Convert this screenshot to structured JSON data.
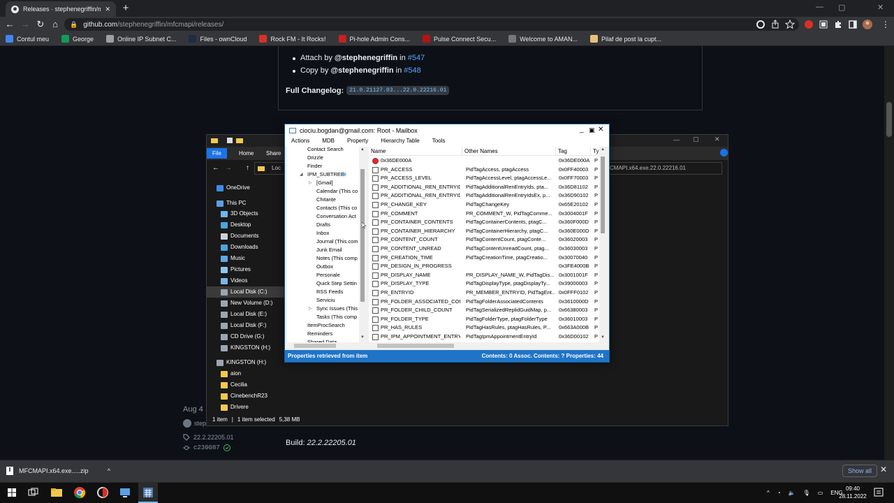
{
  "browser": {
    "tab_title": "Releases · stephenegriffin/mfcmap",
    "new_tab": "+",
    "url_host": "github.com",
    "url_path": "/stephenegriffin/mfcmapi/releases/",
    "win_min": "—",
    "win_max": "▢",
    "win_close": "✕"
  },
  "bookmarks": [
    {
      "label": "Contul meu",
      "color": "#4285f4"
    },
    {
      "label": "George",
      "color": "#0f9d58"
    },
    {
      "label": "Online IP Subnet C...",
      "color": "#9aa0a6"
    },
    {
      "label": "Files - ownCloud",
      "color": "#1d2d44"
    },
    {
      "label": "Rock FM - It Rocks!",
      "color": "#d93025"
    },
    {
      "label": "Pi-hole Admin Cons...",
      "color": "#c5221f"
    },
    {
      "label": "Pulse Connect Secu...",
      "color": "#b31412"
    },
    {
      "label": "Welcome to AMAN...",
      "color": "#777777"
    },
    {
      "label": "Pilaf de post la cupt...",
      "color": "#e8c07a"
    }
  ],
  "release": {
    "item1_pre": "Attach by ",
    "item1_user": "@stephenegriffin",
    "item1_in": " in ",
    "item1_pr": "#547",
    "item2_pre": "Copy by ",
    "item2_user": "@stephenegriffin",
    "item2_in": " in ",
    "item2_pr": "#548",
    "full_changelog_label": "Full Changelog:",
    "full_changelog_value": "21.0.21127.03...22.0.22216.01",
    "date": "Aug 4",
    "author": "step",
    "tag": "22.2.22205.01",
    "commit": "c230087",
    "build_label": "Build: ",
    "build_value": "22.2.22205.01"
  },
  "download": {
    "filename": "MFCMAPI.x64.exe.....zip",
    "chevron": "^",
    "show_all": "Show all",
    "close": "✕"
  },
  "taskbar": {
    "lang": "ENG",
    "time": "09:40",
    "date": "28.11.2022"
  },
  "explorer": {
    "tabs": {
      "file": "File",
      "home": "Home",
      "share": "Share"
    },
    "address_partial": "Loc",
    "address_right": "CMAPI.x64.exe.22.0.22216.01",
    "nav": [
      {
        "label": "OneDrive",
        "color": "#3c8ee8",
        "indent": 14,
        "sel": false
      },
      {
        "label": "This PC",
        "color": "#5aa0e6",
        "indent": 14,
        "sel": false
      },
      {
        "label": "3D Objects",
        "color": "#6fb6f0",
        "indent": 20,
        "sel": false
      },
      {
        "label": "Desktop",
        "color": "#4aa3df",
        "indent": 20,
        "sel": false
      },
      {
        "label": "Documents",
        "color": "#c9d2da",
        "indent": 20,
        "sel": false
      },
      {
        "label": "Downloads",
        "color": "#4aa3df",
        "indent": 20,
        "sel": false
      },
      {
        "label": "Music",
        "color": "#5fa8e8",
        "indent": 20,
        "sel": false
      },
      {
        "label": "Pictures",
        "color": "#8fc5f0",
        "indent": 20,
        "sel": false
      },
      {
        "label": "Videos",
        "color": "#7ab5e8",
        "indent": 20,
        "sel": false
      },
      {
        "label": "Local Disk (C:)",
        "color": "#9aa6b2",
        "indent": 20,
        "sel": true
      },
      {
        "label": "New Volume (D:)",
        "color": "#9aa6b2",
        "indent": 20,
        "sel": false
      },
      {
        "label": "Local Disk (E:)",
        "color": "#9aa6b2",
        "indent": 20,
        "sel": false
      },
      {
        "label": "Local Disk (F:)",
        "color": "#9aa6b2",
        "indent": 20,
        "sel": false
      },
      {
        "label": "CD Drive (G:)",
        "color": "#9aa6b2",
        "indent": 20,
        "sel": false
      },
      {
        "label": "KINGSTON (H:)",
        "color": "#9aa6b2",
        "indent": 20,
        "sel": false
      },
      {
        "label": "KINGSTON (H:)",
        "color": "#9aa6b2",
        "indent": 14,
        "sel": false
      },
      {
        "label": "aion",
        "color": "#f2c94c",
        "indent": 20,
        "sel": false
      },
      {
        "label": "Cecilia",
        "color": "#f2c94c",
        "indent": 20,
        "sel": false
      },
      {
        "label": "CinebenchR23",
        "color": "#f2c94c",
        "indent": 20,
        "sel": false
      },
      {
        "label": "Drivere",
        "color": "#f2c94c",
        "indent": 20,
        "sel": false
      }
    ],
    "status_items": "1 item",
    "status_sep": "|",
    "status_selected": "1 item selected",
    "status_size": "5,38 MB"
  },
  "mfcmapi": {
    "title": "ciociu.bogdan@gmail.com: Root - Mailbox",
    "menu": [
      "Actions",
      "MDB",
      "Property",
      "Hierarchy Table",
      "Tools"
    ],
    "tree": [
      {
        "label": "Contact Search",
        "x": 29,
        "arrow": ""
      },
      {
        "label": "Drizzle",
        "x": 29,
        "arrow": ""
      },
      {
        "label": "Finder",
        "x": 29,
        "arrow": ""
      },
      {
        "label": "IPM_SUBTREE",
        "x": 29,
        "arrow": "◢",
        "blue": true
      },
      {
        "label": "[Gmail]",
        "x": 42,
        "arrow": "▷"
      },
      {
        "label": "Calendar (This co",
        "x": 42,
        "arrow": ""
      },
      {
        "label": "Chitanțe",
        "x": 42,
        "arrow": ""
      },
      {
        "label": "Contacts (This co",
        "x": 42,
        "arrow": ""
      },
      {
        "label": "Conversation Act",
        "x": 42,
        "arrow": ""
      },
      {
        "label": "Drafts",
        "x": 42,
        "arrow": ""
      },
      {
        "label": "Inbox",
        "x": 42,
        "arrow": ""
      },
      {
        "label": "Journal (This com",
        "x": 42,
        "arrow": ""
      },
      {
        "label": "Junk Email",
        "x": 42,
        "arrow": ""
      },
      {
        "label": "Notes (This comp",
        "x": 42,
        "arrow": ""
      },
      {
        "label": "Outbox",
        "x": 42,
        "arrow": ""
      },
      {
        "label": "Personale",
        "x": 42,
        "arrow": ""
      },
      {
        "label": "Quick Step Settin",
        "x": 42,
        "arrow": ""
      },
      {
        "label": "RSS Feeds",
        "x": 42,
        "arrow": ""
      },
      {
        "label": "Serviciu",
        "x": 42,
        "arrow": ""
      },
      {
        "label": "Sync Issues (This",
        "x": 42,
        "arrow": "▷"
      },
      {
        "label": "Tasks (This comp",
        "x": 42,
        "arrow": ""
      },
      {
        "label": "ItemProcSearch",
        "x": 29,
        "arrow": ""
      },
      {
        "label": "Reminders",
        "x": 29,
        "arrow": ""
      },
      {
        "label": "Shared Data",
        "x": 29,
        "arrow": ""
      }
    ],
    "columns": {
      "name": "Name",
      "other": "Other Names",
      "tag": "Tag",
      "type": "Ty"
    },
    "rows": [
      {
        "name": "0x36DE000A",
        "other": "",
        "tag": "0x36DE000A",
        "type": "P",
        "err": true
      },
      {
        "name": "PR_ACCESS",
        "other": "PidTagAccess, ptagAccess",
        "tag": "0x0FF40003",
        "type": "P"
      },
      {
        "name": "PR_ACCESS_LEVEL",
        "other": "PidTagAccessLevel, ptagAccessLe...",
        "tag": "0x0FF70003",
        "type": "P"
      },
      {
        "name": "PR_ADDITIONAL_REN_ENTRYIDS",
        "other": "PidTagAdditionalRenEntryIds, pta...",
        "tag": "0x36D81102",
        "type": "P"
      },
      {
        "name": "PR_ADDITIONAL_REN_ENTRYID...",
        "other": "PidTagAdditionalRenEntryIdsEx, p...",
        "tag": "0x36D90102",
        "type": "P"
      },
      {
        "name": "PR_CHANGE_KEY",
        "other": "PidTagChangeKey",
        "tag": "0x65E20102",
        "type": "P"
      },
      {
        "name": "PR_COMMENT",
        "other": "PR_COMMENT_W, PidTagComme...",
        "tag": "0x3004001F",
        "type": "P"
      },
      {
        "name": "PR_CONTAINER_CONTENTS",
        "other": "PidTagContainerContents, ptagC...",
        "tag": "0x360F000D",
        "type": "P"
      },
      {
        "name": "PR_CONTAINER_HIERARCHY",
        "other": "PidTagContainerHierarchy, ptagC...",
        "tag": "0x360E000D",
        "type": "P"
      },
      {
        "name": "PR_CONTENT_COUNT",
        "other": "PidTagContentCount, ptagConte...",
        "tag": "0x36020003",
        "type": "P"
      },
      {
        "name": "PR_CONTENT_UNREAD",
        "other": "PidTagContentUnreadCount, ptag...",
        "tag": "0x36030003",
        "type": "P"
      },
      {
        "name": "PR_CREATION_TIME",
        "other": "PidTagCreationTime, ptagCreatio...",
        "tag": "0x30070040",
        "type": "P"
      },
      {
        "name": "PR_DESIGN_IN_PROGRESS",
        "other": "",
        "tag": "0x3FE4000B",
        "type": "P"
      },
      {
        "name": "PR_DISPLAY_NAME",
        "other": "PR_DISPLAY_NAME_W, PidTagDis...",
        "tag": "0x3001001F",
        "type": "P"
      },
      {
        "name": "PR_DISPLAY_TYPE",
        "other": "PidTagDisplayType, ptagDisplayTy...",
        "tag": "0x39000003",
        "type": "P"
      },
      {
        "name": "PR_ENTRYID",
        "other": "PR_MEMBER_ENTRYID, PidTagEnt...",
        "tag": "0x0FFF0102",
        "type": "P"
      },
      {
        "name": "PR_FOLDER_ASSOCIATED_CON...",
        "other": "PidTagFolderAssociatedContents",
        "tag": "0x3610000D",
        "type": "P"
      },
      {
        "name": "PR_FOLDER_CHILD_COUNT",
        "other": "PidTagSerializedReplidGuidMap, p...",
        "tag": "0x66380003",
        "type": "P"
      },
      {
        "name": "PR_FOLDER_TYPE",
        "other": "PidTagFolderType, ptagFolderType",
        "tag": "0x36010003",
        "type": "P"
      },
      {
        "name": "PR_HAS_RULES",
        "other": "PidTagHasRules, ptagHasRules, P...",
        "tag": "0x663A000B",
        "type": "P"
      },
      {
        "name": "PR_IPM_APPOINTMENT_ENTRY...",
        "other": "PidTagIpmAppointmentEntryId",
        "tag": "0x36D00102",
        "type": "P"
      }
    ],
    "status_left": "Properties retrieved from item",
    "status_right": "Contents: 0 Assoc. Contents: ?  Properties: 44"
  }
}
